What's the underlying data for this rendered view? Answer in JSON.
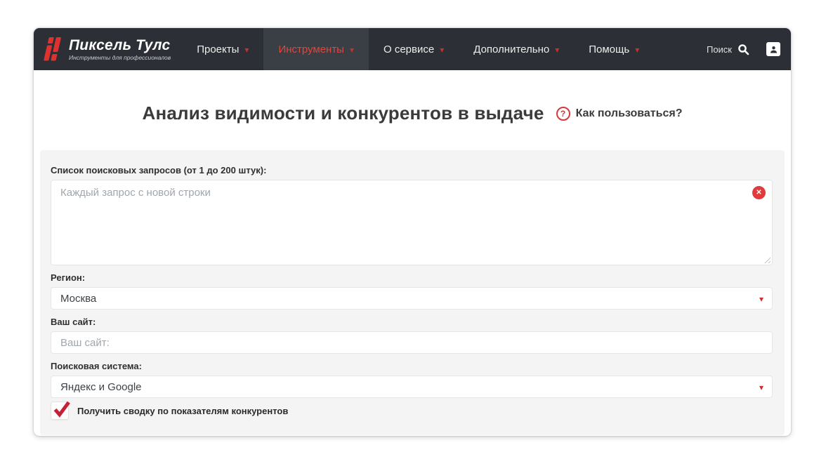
{
  "header": {
    "logo": {
      "title": "Пиксель Тулс",
      "tagline": "Инструменты для профессионалов"
    },
    "nav": [
      {
        "label": "Проекты"
      },
      {
        "label": "Инструменты"
      },
      {
        "label": "О сервисе"
      },
      {
        "label": "Дополнительно"
      },
      {
        "label": "Помощь"
      }
    ],
    "active_nav": "Инструменты",
    "search_label": "Поиск"
  },
  "main": {
    "title": "Анализ видимости и конкурентов в выдаче",
    "help": {
      "icon": "?",
      "label": "Как пользоваться?"
    }
  },
  "form": {
    "queries": {
      "label": "Список поисковых запросов (от 1 до 200 штук):",
      "placeholder": "Каждый запрос с новой строки",
      "value": ""
    },
    "region": {
      "label": "Регион:",
      "value": "Москва"
    },
    "site": {
      "label": "Ваш сайт:",
      "placeholder": "Ваш сайт:",
      "value": ""
    },
    "engine": {
      "label": "Поисковая система:",
      "value": "Яндекс и Google"
    },
    "competitors": {
      "label": "Получить сводку по показателям конкурентов",
      "checked": true
    }
  },
  "icons": {
    "caret_down": "▾",
    "clear": "✕",
    "logo_mark": "pixel-tools-mark",
    "search": "magnifier",
    "user": "person",
    "help": "question-circle",
    "check": "red-checkmark"
  },
  "colors": {
    "accent_red": "#e03131",
    "header_bg": "#2c2f35",
    "header_active_bg": "#3a3f46",
    "panel_bg": "#f4f4f4",
    "check_red": "#c62237",
    "clear_red": "#e23b3b"
  }
}
